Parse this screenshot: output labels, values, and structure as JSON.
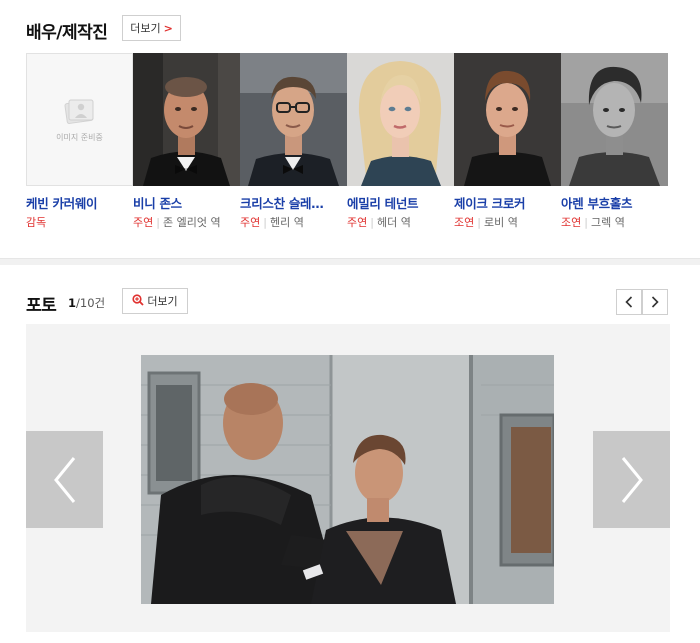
{
  "cast_section": {
    "title": "배우/제작진",
    "more_label": "더보기",
    "members": [
      {
        "name": "케빈 카러웨이",
        "role": "감독",
        "character": "",
        "has_photo": false,
        "placeholder_text": "이미지 준비중"
      },
      {
        "name": "비니 존스",
        "role": "주연",
        "character": "존 엘리엇 역",
        "has_photo": true
      },
      {
        "name": "크리스찬 슬레…",
        "role": "주연",
        "character": "헨리 역",
        "has_photo": true
      },
      {
        "name": "에밀리 테넌트",
        "role": "주연",
        "character": "헤더 역",
        "has_photo": true
      },
      {
        "name": "제이크 크로커",
        "role": "조연",
        "character": "로비 역",
        "has_photo": true
      },
      {
        "name": "아렌 부흐홀츠",
        "role": "조연",
        "character": "그렉 역",
        "has_photo": true
      }
    ]
  },
  "photo_section": {
    "title": "포토",
    "current": "1",
    "total": "/10건",
    "more_label": "더보기"
  },
  "colors": {
    "accent_red": "#e0312f",
    "name_blue": "#1a3fa8",
    "viewer_bg": "#f3f3f3",
    "arrow_bg": "#c8c8c8"
  },
  "icons": {
    "more_chevron": "chevron-right-icon",
    "more_magnifier": "magnifier-plus-icon",
    "nav_prev": "chevron-left-icon",
    "nav_next": "chevron-right-icon"
  }
}
